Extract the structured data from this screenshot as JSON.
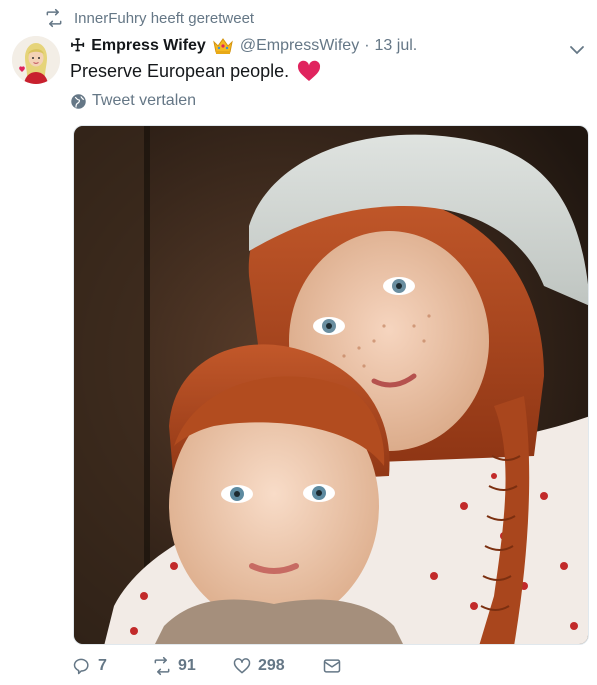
{
  "retweet_context": {
    "text": "InnerFuhry heeft geretweet",
    "icon": "retweet-icon"
  },
  "tweet": {
    "prefix_symbol": "☩",
    "display_name": "Empress Wifey",
    "handle": "@EmpressWifey",
    "separator": "·",
    "date": "13 jul.",
    "text": "Preserve European people.",
    "translate_label": "Tweet vertalen"
  },
  "actions": {
    "reply_count": "7",
    "retweet_count": "91",
    "like_count": "298"
  },
  "colors": {
    "secondary_text": "#657786",
    "heart": "#e0245e"
  }
}
